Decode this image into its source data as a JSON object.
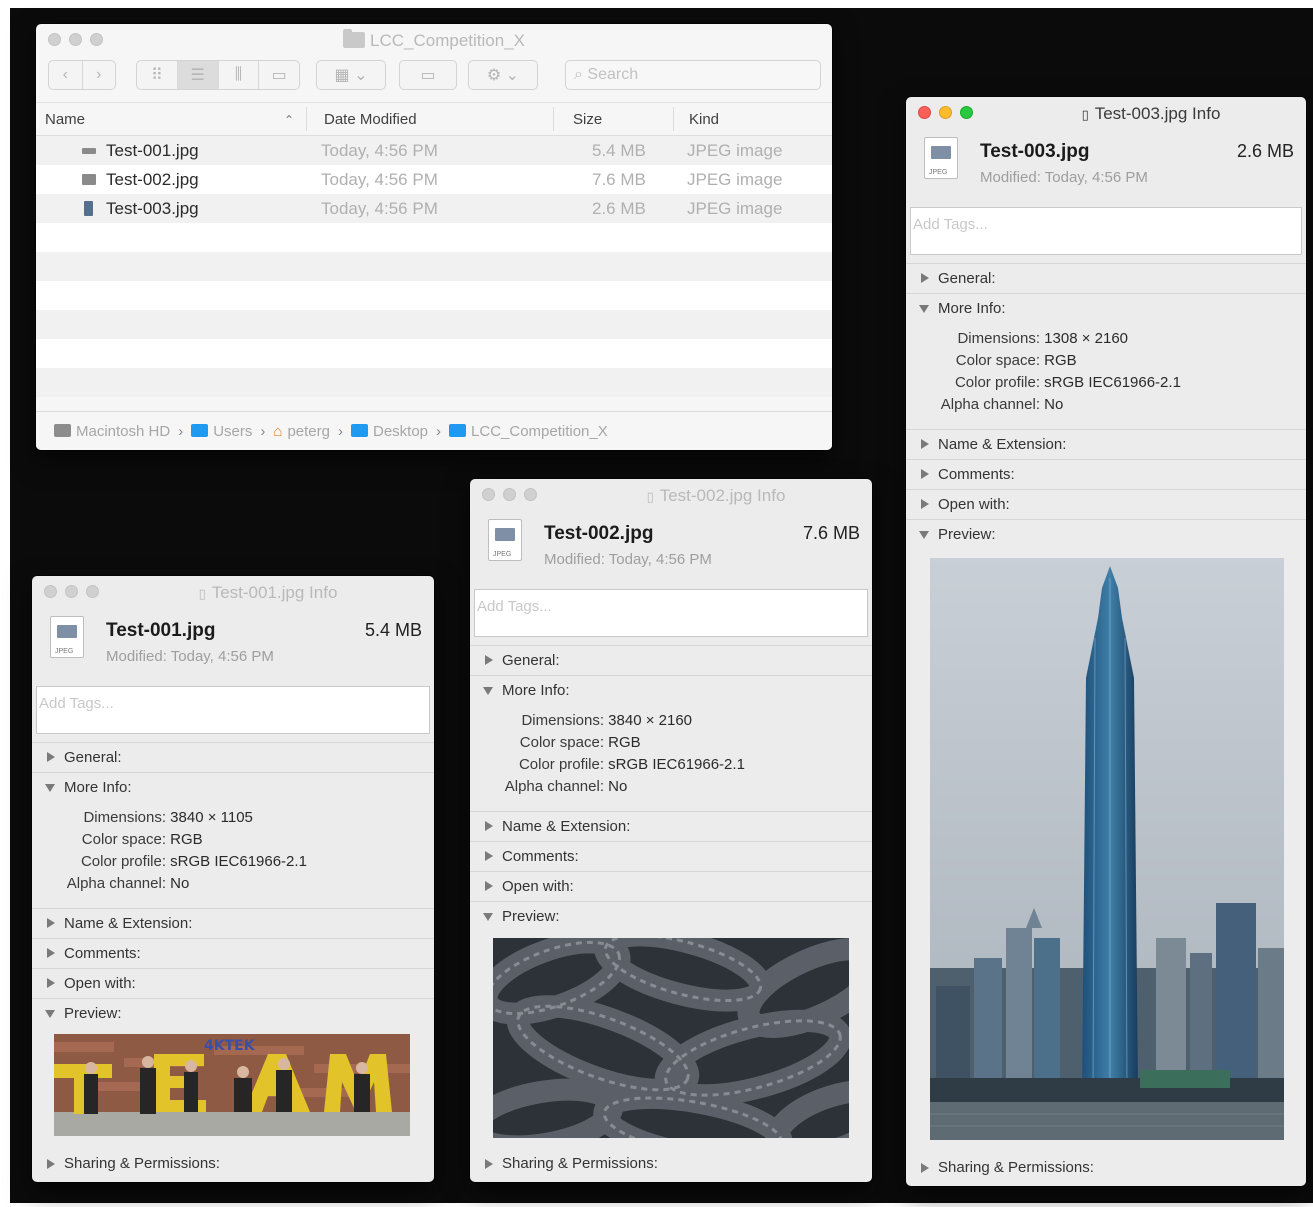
{
  "finder": {
    "title": "LCC_Competition_X",
    "search_placeholder": "Search",
    "columns": {
      "name": "Name",
      "date": "Date Modified",
      "size": "Size",
      "kind": "Kind"
    },
    "files": [
      {
        "name": "Test-001.jpg",
        "date": "Today, 4:56 PM",
        "size": "5.4 MB",
        "kind": "JPEG image"
      },
      {
        "name": "Test-002.jpg",
        "date": "Today, 4:56 PM",
        "size": "7.6 MB",
        "kind": "JPEG image"
      },
      {
        "name": "Test-003.jpg",
        "date": "Today, 4:56 PM",
        "size": "2.6 MB",
        "kind": "JPEG image"
      }
    ],
    "path": [
      "Macintosh HD",
      "Users",
      "peterg",
      "Desktop",
      "LCC_Competition_X"
    ]
  },
  "labels": {
    "add_tags": "Add Tags...",
    "general": "General:",
    "more_info": "More Info:",
    "name_ext": "Name & Extension:",
    "comments": "Comments:",
    "open_with": "Open with:",
    "preview": "Preview:",
    "sharing": "Sharing & Permissions:",
    "dimensions": "Dimensions:",
    "color_space": "Color space:",
    "color_profile": "Color profile:",
    "alpha_channel": "Alpha channel:"
  },
  "info1": {
    "title": "Test-001.jpg Info",
    "filename": "Test-001.jpg",
    "size": "5.4 MB",
    "modified": "Modified: Today, 4:56 PM",
    "dimensions": "3840 × 1105",
    "color_space": "RGB",
    "color_profile": "sRGB IEC61966-2.1",
    "alpha_channel": "No"
  },
  "info2": {
    "title": "Test-002.jpg Info",
    "filename": "Test-002.jpg",
    "size": "7.6 MB",
    "modified": "Modified: Today, 4:56 PM",
    "dimensions": "3840 × 2160",
    "color_space": "RGB",
    "color_profile": "sRGB IEC61966-2.1",
    "alpha_channel": "No"
  },
  "info3": {
    "title": "Test-003.jpg Info",
    "filename": "Test-003.jpg",
    "size": "2.6 MB",
    "modified": "Modified: Today, 4:56 PM",
    "dimensions": "1308 × 2160",
    "color_space": "RGB",
    "color_profile": "sRGB IEC61966-2.1",
    "alpha_channel": "No"
  },
  "colors": {
    "desktop": "#0b0b0b",
    "window": "#ececec",
    "folder_blue": "#1e9bf0",
    "close_red": "#fc5f57",
    "minimize_yellow": "#fdbc2e",
    "zoom_green": "#28c840"
  }
}
